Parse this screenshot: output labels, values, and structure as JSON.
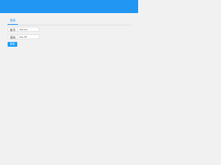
{
  "colors": {
    "header": "#2196f3",
    "accent": "#1890ff",
    "button": "#1e9fff",
    "background": "#f1f1f1"
  },
  "tabs": [
    {
      "label": "登录",
      "active": true
    }
  ],
  "form": {
    "fields": [
      {
        "label": "账号",
        "value": "ddc-ccc"
      },
      {
        "label": "密码",
        "value": "ddc-ftS"
      }
    ],
    "submit_label": "登录"
  }
}
